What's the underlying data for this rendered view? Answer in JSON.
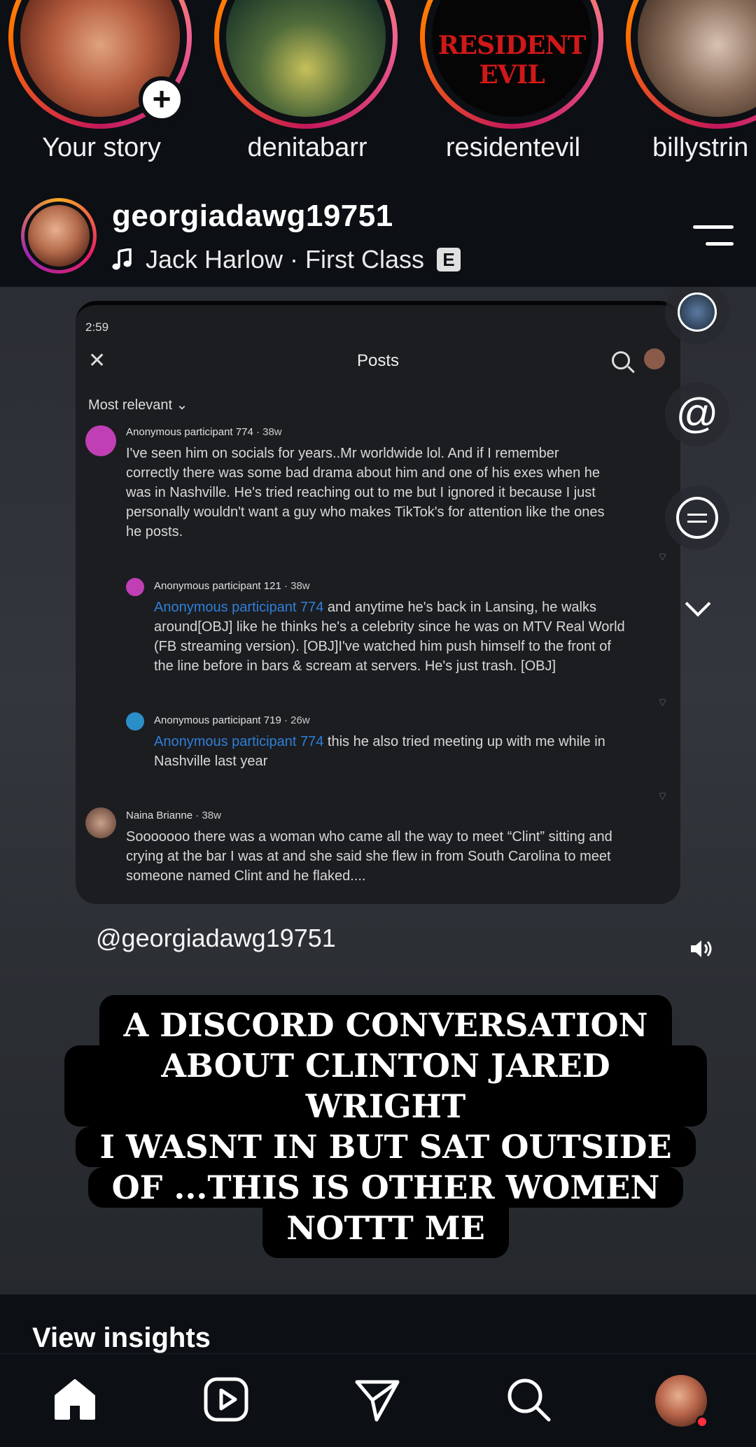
{
  "stories": [
    {
      "label": "Your story",
      "icon": "add-icon"
    },
    {
      "label": "denitabarr"
    },
    {
      "label": "residentevil",
      "thumb_text": "RESIDENT EVIL"
    },
    {
      "label": "billystrin"
    }
  ],
  "post": {
    "username": "georgiadawg19751",
    "music": "Jack Harlow · First Class",
    "explicit_badge": "E"
  },
  "screenshot": {
    "time": "2:59",
    "title": "Posts",
    "sort": "Most relevant",
    "comments": [
      {
        "author": "Anonymous participant 774",
        "age": "38w",
        "lines": [
          "I've seen him on socials for years..Mr worldwide lol. And if I remember",
          "correctly there was some bad drama about him and one of his exes when he",
          "was in Nashville. He's tried reaching out to me but I ignored it because I just",
          "personally wouldn't want a guy who makes TikTok's for attention like the ones",
          "he posts."
        ]
      },
      {
        "author": "Anonymous participant 121",
        "age": "38w",
        "mention": "Anonymous participant 774",
        "lines": [
          " and anytime he's back in Lansing, he walks",
          "around[OBJ] like he thinks he's a celebrity since he was on MTV Real World",
          "(FB streaming version). [OBJ]I've watched him push himself to the front of",
          "the line before in bars & scream at servers. He's just trash. [OBJ]"
        ]
      },
      {
        "author": "Anonymous participant 719",
        "age": "26w",
        "mention": "Anonymous participant 774",
        "lines": [
          " this he also tried meeting up with me while in",
          "Nashville last year"
        ]
      },
      {
        "author": "Naina Brianne",
        "age": "38w",
        "lines": [
          "Sooooooo there was a woman who came all the way to meet “Clint” sitting and",
          "crying at the bar I was at and she said she flew in from South Carolina to meet",
          "someone named Clint and he flaked...."
        ]
      }
    ]
  },
  "tag": "@georgiadawg19751",
  "caption": [
    "A DISCORD CONVERSATION",
    "ABOUT CLINTON JARED WRIGHT",
    "I WASNT IN BUT SAT OUTSIDE",
    "OF ...THIS IS OTHER WOMEN",
    "NOTTT ME"
  ],
  "insights_label": "View insights",
  "colors": {
    "background": "#0c0f14",
    "mention": "#2f7fd8",
    "notification": "#ff2d3d"
  },
  "nav": [
    "home-icon",
    "reels-icon",
    "send-icon",
    "search-icon",
    "profile-avatar"
  ]
}
